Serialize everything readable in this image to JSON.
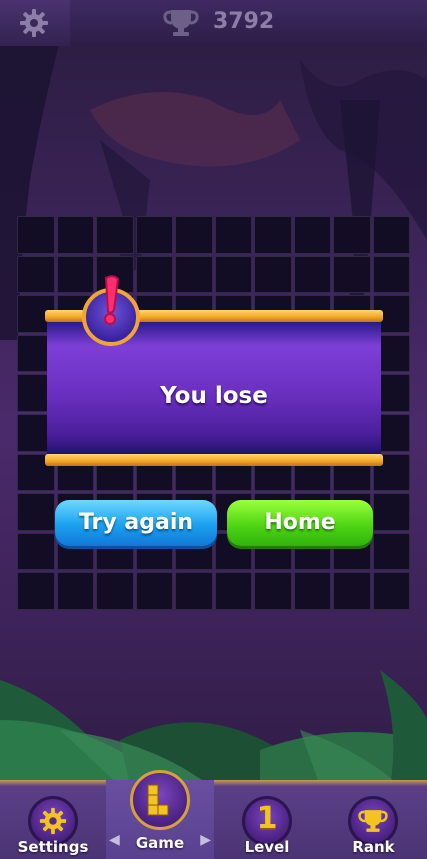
{
  "header": {
    "score": "3792"
  },
  "dialog": {
    "title": "You lose"
  },
  "buttons": {
    "try_again": "Try again",
    "home": "Home"
  },
  "nav": {
    "items": [
      {
        "label": "Settings",
        "icon": "gear-icon"
      },
      {
        "label": "Game",
        "icon": "block-icon"
      },
      {
        "label": "Level",
        "icon": "level-icon",
        "value": "1"
      },
      {
        "label": "Rank",
        "icon": "trophy-icon"
      }
    ]
  },
  "colors": {
    "accent_gold": "#f0a635",
    "panel": "#6a2fc0",
    "try_button": "#1aa0ef",
    "home_button": "#4fd614"
  }
}
